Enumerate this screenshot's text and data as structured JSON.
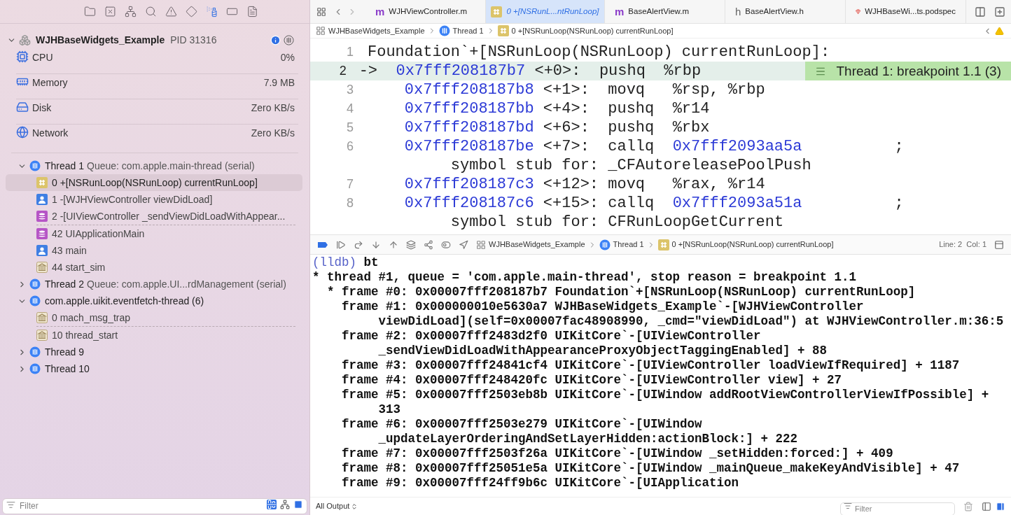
{
  "navigator_tabs": [
    {
      "kind": "project",
      "selected": false
    },
    {
      "kind": "source-control",
      "selected": false
    },
    {
      "kind": "symbols",
      "selected": false
    },
    {
      "kind": "find",
      "selected": false
    },
    {
      "kind": "issues",
      "selected": false
    },
    {
      "kind": "tests",
      "selected": false
    },
    {
      "kind": "debug",
      "selected": true
    },
    {
      "kind": "breakpoints",
      "selected": false
    },
    {
      "kind": "reports",
      "selected": false
    }
  ],
  "process": {
    "name": "WJHBaseWidgets_Example",
    "pid": "PID 31316"
  },
  "gauges": [
    {
      "kind": "cpu",
      "label": "CPU",
      "value": "0%"
    },
    {
      "kind": "memory",
      "label": "Memory",
      "value": "7.9 MB"
    },
    {
      "kind": "disk",
      "label": "Disk",
      "value": "Zero KB/s"
    },
    {
      "kind": "network",
      "label": "Network",
      "value": "Zero KB/s"
    }
  ],
  "threads": [
    {
      "name": "Thread 1",
      "queue": "Queue: com.apple.main-thread (serial)",
      "expanded": true,
      "frames": [
        {
          "kind": "assembly",
          "label": "0 +[NSRunLoop(NSRunLoop) currentRunLoop]",
          "selected": true,
          "gap_after": false
        },
        {
          "kind": "user",
          "label": "1 -[WJHViewController viewDidLoad]",
          "selected": false,
          "gap_after": false
        },
        {
          "kind": "framework",
          "label": "2 -[UIViewController _sendViewDidLoadWithAppear...",
          "selected": false,
          "gap_after": true
        },
        {
          "kind": "framework",
          "label": "42 UIApplicationMain",
          "selected": false,
          "gap_after": false
        },
        {
          "kind": "user",
          "label": "43 main",
          "selected": false,
          "gap_after": false
        },
        {
          "kind": "system",
          "label": "44 start_sim",
          "selected": false,
          "gap_after": false
        }
      ]
    },
    {
      "name": "Thread 2",
      "queue": "Queue: com.apple.UI...rdManagement (serial)",
      "expanded": false
    },
    {
      "name": "com.apple.uikit.eventfetch-thread (6)",
      "expanded": true,
      "frames": [
        {
          "kind": "system",
          "label": "0 mach_msg_trap",
          "selected": false,
          "gap_after": true
        },
        {
          "kind": "system",
          "label": "10 thread_start",
          "selected": false,
          "gap_after": false
        }
      ]
    },
    {
      "name": "Thread 9",
      "expanded": false
    },
    {
      "name": "Thread 10",
      "expanded": false
    }
  ],
  "navigator_filter": {
    "placeholder": "Filter"
  },
  "editor_tabs": [
    {
      "kind": "source",
      "letter": "m",
      "label": "WJHViewController.m",
      "selected": false
    },
    {
      "kind": "frame",
      "label": "0 +[NSRunL...ntRunLoop]",
      "selected": true
    },
    {
      "kind": "source",
      "letter": "m",
      "label": "BaseAlertView.m",
      "selected": false
    },
    {
      "kind": "header",
      "letter": "h",
      "label": "BaseAlertView.h",
      "selected": false
    },
    {
      "kind": "podspec",
      "label": "WJHBaseWi...ts.podspec",
      "selected": false
    }
  ],
  "jump_bar": [
    {
      "kind": "app",
      "label": "WJHBaseWidgets_Example"
    },
    {
      "kind": "thread",
      "label": "Thread 1"
    },
    {
      "kind": "frame",
      "label": "0 +[NSRunLoop(NSRunLoop) currentRunLoop]"
    }
  ],
  "code": [
    {
      "number": "1",
      "kind": "label",
      "text": "Foundation`+[NSRunLoop(NSRunLoop) currentRunLoop]:",
      "current": false
    },
    {
      "number": "2",
      "kind": "instruction",
      "arrow": "->",
      "address": "0x7fff208187b7",
      "offset": "<+0>:",
      "mnemonic": "pushq",
      "operands": "%rbp",
      "current": true,
      "annotation": "Thread 1: breakpoint 1.1 (3)"
    },
    {
      "number": "3",
      "kind": "instruction",
      "address": "0x7fff208187b8",
      "offset": "<+1>:",
      "mnemonic": "movq",
      "operands": "%rsp, %rbp",
      "current": false
    },
    {
      "number": "4",
      "kind": "instruction",
      "address": "0x7fff208187bb",
      "offset": "<+4>:",
      "mnemonic": "pushq",
      "operands": "%r14",
      "current": false
    },
    {
      "number": "5",
      "kind": "instruction",
      "address": "0x7fff208187bd",
      "offset": "<+6>:",
      "mnemonic": "pushq",
      "operands": "%rbx",
      "current": false
    },
    {
      "number": "6",
      "kind": "instruction",
      "address": "0x7fff208187be",
      "offset": "<+7>:",
      "mnemonic": "callq",
      "target": "0x7fff2093aa5a",
      "comment": ";",
      "note": "symbol stub for: _CFAutoreleasePoolPush",
      "current": false
    },
    {
      "number": "7",
      "kind": "instruction",
      "address": "0x7fff208187c3",
      "offset": "<+12>:",
      "mnemonic": "movq",
      "operands": "%rax, %r14",
      "current": false
    },
    {
      "number": "8",
      "kind": "instruction",
      "address": "0x7fff208187c6",
      "offset": "<+15>:",
      "mnemonic": "callq",
      "target": "0x7fff2093a51a",
      "comment": ";",
      "note": "symbol stub for: CFRunLoopGetCurrent",
      "current": false
    }
  ],
  "debug_bar": {
    "jump_bar": [
      {
        "kind": "app",
        "label": "WJHBaseWidgets_Example"
      },
      {
        "kind": "thread",
        "label": "Thread 1"
      },
      {
        "kind": "frame",
        "label": "0 +[NSRunLoop(NSRunLoop) currentRunLoop]"
      }
    ],
    "position": "Line: 2  Col: 1"
  },
  "console": {
    "prompt": "(lldb)",
    "command": "bt",
    "header": "* thread #1, queue = 'com.apple.main-thread', stop reason = breakpoint 1.1",
    "frames": [
      {
        "marker": "*",
        "lines": [
          "frame #0: 0x00007fff208187b7 Foundation`+[NSRunLoop(NSRunLoop) currentRunLoop]"
        ]
      },
      {
        "lines": [
          "frame #1: 0x000000010e5630a7 WJHBaseWidgets_Example`-[WJHViewController",
          "viewDidLoad](self=0x00007fac48908990, _cmd=\"viewDidLoad\") at WJHViewController.m:36:5"
        ]
      },
      {
        "lines": [
          "frame #2: 0x00007fff2483d2f0 UIKitCore`-[UIViewController",
          "_sendViewDidLoadWithAppearanceProxyObjectTaggingEnabled] + 88"
        ]
      },
      {
        "lines": [
          "frame #3: 0x00007fff24841cf4 UIKitCore`-[UIViewController loadViewIfRequired] + 1187"
        ]
      },
      {
        "lines": [
          "frame #4: 0x00007fff248420fc UIKitCore`-[UIViewController view] + 27"
        ]
      },
      {
        "lines": [
          "frame #5: 0x00007fff2503eb8b UIKitCore`-[UIWindow addRootViewControllerViewIfPossible] +",
          "313"
        ]
      },
      {
        "lines": [
          "frame #6: 0x00007fff2503e279 UIKitCore`-[UIWindow",
          "_updateLayerOrderingAndSetLayerHidden:actionBlock:] + 222"
        ]
      },
      {
        "lines": [
          "frame #7: 0x00007fff2503f26a UIKitCore`-[UIWindow _setHidden:forced:] + 409"
        ]
      },
      {
        "lines": [
          "frame #8: 0x00007fff25051e5a UIKitCore`-[UIWindow _mainQueue_makeKeyAndVisible] + 47"
        ]
      },
      {
        "lines": [
          "frame #9: 0x00007fff24ff9b6c UIKitCore`-[UIApplication"
        ]
      }
    ]
  },
  "console_bar": {
    "scope": "All Output",
    "filter": {
      "placeholder": "Filter"
    }
  }
}
